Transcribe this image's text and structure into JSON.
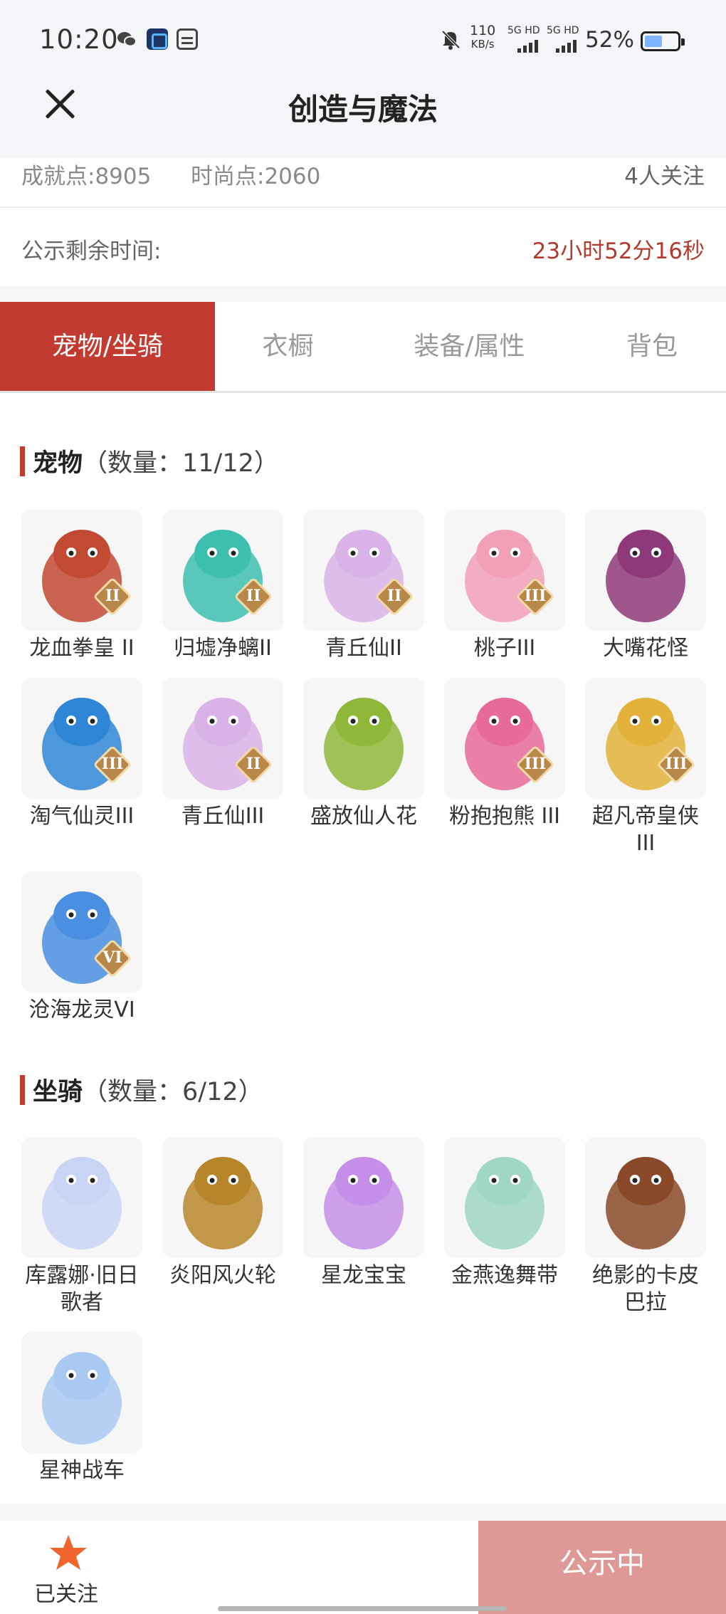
{
  "status_bar": {
    "time": "10:20",
    "speed_value": "110",
    "speed_unit": "KB/s",
    "network1": "5G HD",
    "network2": "5G HD",
    "battery": "52%",
    "icons": [
      "wechat-icon",
      "app-icon",
      "card-icon",
      "bell-muted-icon",
      "battery-icon"
    ]
  },
  "header": {
    "title": "创造与魔法"
  },
  "info": {
    "achievement": "成就点:8905",
    "fashion": "时尚点:2060",
    "followers": "4人关注",
    "timer_label": "公示剩余时间:",
    "timer_value": "23小时52分16秒"
  },
  "tabs": [
    {
      "label": "宠物/坐骑",
      "active": true
    },
    {
      "label": "衣橱",
      "active": false
    },
    {
      "label": "装备/属性",
      "active": false
    },
    {
      "label": "背包",
      "active": false
    }
  ],
  "pets": {
    "title": "宠物",
    "count": "（数量：11/12）",
    "items": [
      {
        "label": "龙血拳皇 II",
        "badge": "II",
        "color": "#c24a33"
      },
      {
        "label": "归墟净螭II",
        "badge": "II",
        "color": "#3dbfb0"
      },
      {
        "label": "青丘仙II",
        "badge": "II",
        "color": "#d9b3e8"
      },
      {
        "label": "桃子III",
        "badge": "III",
        "color": "#f2a0b8"
      },
      {
        "label": "大嘴花怪",
        "badge": "",
        "color": "#8e3a7a"
      },
      {
        "label": "淘气仙灵III",
        "badge": "III",
        "color": "#2f86d6"
      },
      {
        "label": "青丘仙III",
        "badge": "II",
        "color": "#d9b3e8"
      },
      {
        "label": "盛放仙人花",
        "badge": "",
        "color": "#8fb83a"
      },
      {
        "label": "粉抱抱熊 III",
        "badge": "III",
        "color": "#e86a9a"
      },
      {
        "label": "超凡帝皇侠III",
        "badge": "III",
        "color": "#e2b23a"
      },
      {
        "label": "沧海龙灵VI",
        "badge": "VI",
        "color": "#4a8fe0"
      }
    ]
  },
  "mounts": {
    "title": "坐骑",
    "count": "（数量：6/12）",
    "items": [
      {
        "label": "库露娜·旧日歌者",
        "color": "#c9d4f5"
      },
      {
        "label": "炎阳风火轮",
        "color": "#b8862a"
      },
      {
        "label": "星龙宝宝",
        "color": "#c58ee8"
      },
      {
        "label": "金燕逸舞带",
        "color": "#9fd6c4"
      },
      {
        "label": "绝影的卡皮巴拉",
        "color": "#8a4a2a"
      },
      {
        "label": "星神战车",
        "color": "#a9c9f2"
      }
    ]
  },
  "bottom_bar": {
    "follow_label": "已关注",
    "status_label": "公示中",
    "accent_color": "#c33a31",
    "status_color": "#de9896",
    "star_color": "#f0642d"
  }
}
